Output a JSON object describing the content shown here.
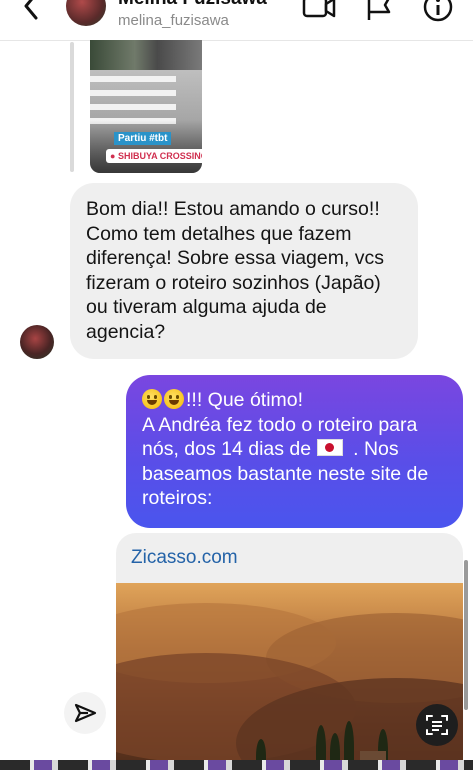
{
  "header": {
    "display_name": "Melina Fuzisawa",
    "username": "melina_fuzisawa",
    "icons": [
      "back-chevron-icon",
      "video-call-icon",
      "flag-icon",
      "info-icon"
    ]
  },
  "story": {
    "caption": "Partiu #tbt",
    "location": "SHIBUYA CROSSING"
  },
  "messages": {
    "incoming": "Bom dia!! Estou amando o curso!!\nComo tem detalhes que fazem\ndiferença! Sobre essa viagem, vcs\nfizeram o roteiro sozinhos (Japão)\nou tiveram alguma ajuda de\nagencia?",
    "outgoing": {
      "line1": "!!! Que ótimo!",
      "line2": "A Andréa fez todo o roteiro para",
      "line3_before_flag": "nós, dos 14 dias de",
      "line3_after_flag": ". Nos",
      "line4": "baseamos bastante neste site de",
      "line5": "roteiros:"
    }
  },
  "link_preview": {
    "title": "Zicasso.com"
  },
  "colors": {
    "outgoing_gradient_top": "#7a46e0",
    "outgoing_gradient_bottom": "#4a55ee",
    "incoming_bubble": "#efefef",
    "link_text": "#2463a8"
  }
}
